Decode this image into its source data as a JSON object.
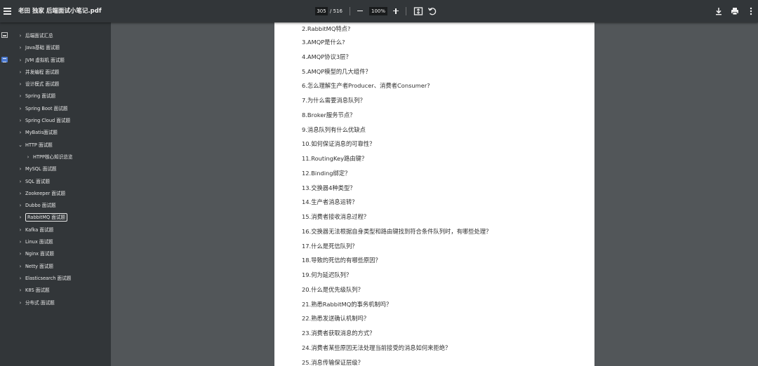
{
  "toolbar": {
    "title": "老田 独家 后端面试小笔记.pdf",
    "current_page": "305",
    "page_total": "/ 516",
    "zoom": "100%",
    "icons": [
      "menu-icon",
      "zoom-out-icon",
      "zoom-in-icon",
      "fit-page-icon",
      "rotate-icon",
      "download-icon",
      "print-icon",
      "more-vert-icon"
    ]
  },
  "sidebar": {
    "icons": [
      "thumbnails-icon",
      "outline-icon"
    ],
    "items": [
      {
        "label": "后端面试汇总",
        "chevron": "›"
      },
      {
        "label": "Java基础 面试题",
        "chevron": "›"
      },
      {
        "label": "JVM 虚拟机 面试题",
        "chevron": "›"
      },
      {
        "label": "并发编程 面试题",
        "chevron": "›"
      },
      {
        "label": "设计模式 面试题",
        "chevron": "›"
      },
      {
        "label": "Spring 面试题",
        "chevron": "›"
      },
      {
        "label": "Spring Boot 面试题",
        "chevron": "›"
      },
      {
        "label": "Spring Cloud 面试题",
        "chevron": "›"
      },
      {
        "label": "MyBatis面试题",
        "chevron": "›"
      },
      {
        "label": "HTTP 面试题",
        "chevron": "⌄"
      },
      {
        "label": "HTPP核心知识总览",
        "chevron": "›"
      },
      {
        "label": "MySQL 面试题",
        "chevron": "›"
      },
      {
        "label": "SQL 面试题",
        "chevron": "›"
      },
      {
        "label": "Zookeeper 面试题",
        "chevron": "›"
      },
      {
        "label": "Dubbo 面试题",
        "chevron": "›"
      },
      {
        "label": "RabbitMQ 面试题",
        "chevron": "›"
      },
      {
        "label": "Kafka 面试题",
        "chevron": "›"
      },
      {
        "label": "Linux 面试题",
        "chevron": "›"
      },
      {
        "label": "Nginx 面试题",
        "chevron": "›"
      },
      {
        "label": "Netty 面试题",
        "chevron": "›"
      },
      {
        "label": "Elasticsearch 面试题",
        "chevron": "›"
      },
      {
        "label": "K8S 面试题",
        "chevron": "›"
      },
      {
        "label": "分布式 面试题",
        "chevron": "›"
      }
    ]
  },
  "page": {
    "questions": [
      "2.RabbitMQ特点?",
      "3.AMQP是什么?",
      "4.AMQP协议3层？",
      "5.AMQP模型的几大组件？",
      "6.怎么理解生产者Producer、消费者Consumer?",
      "7.为什么需要消息队列？",
      "8.Broker服务节点？",
      "9.消息队列有什么优缺点",
      "10.如何保证消息的可靠性？",
      "11.RoutingKey路由键？",
      "12.Binding绑定？",
      "13.交换器4种类型？",
      "14.生产者消息运转？",
      "15.消费者接收消息过程？",
      "16.交换器无法根据自身类型和路由键找到符合条件队列时，有哪些处理？",
      "17.什么是死信队列？",
      "18.导致的死信的有哪些原因？",
      "19.何为延迟队列？",
      "20.什么是优先级队列？",
      "21.熟悉RabbitMQ的事务机制吗？",
      "22.熟悉发送确认机制吗？",
      "23.消费者获取消息的方式？",
      "24.消费者某些原因无法处理当前接受的消息如何来拒绝？",
      "25.消息传输保证层级？"
    ]
  }
}
